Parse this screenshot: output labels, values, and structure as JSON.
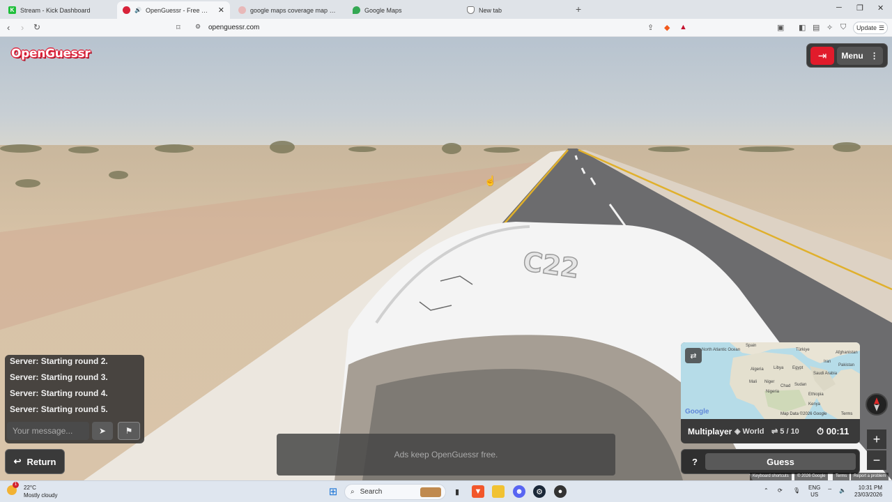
{
  "browser": {
    "tabs": [
      {
        "title": "Stream - Kick Dashboard",
        "fav_color": "#1fbf3b",
        "fav_glyph": "K"
      },
      {
        "title": "OpenGuessr - Free GeoGuessr",
        "fav_color": "#d8233a",
        "fav_glyph": ""
      },
      {
        "title": "google maps coverage map world - S",
        "fav_color": "#e05757",
        "fav_glyph": ""
      },
      {
        "title": "Google Maps",
        "fav_color": "#34a853",
        "fav_glyph": ""
      },
      {
        "title": "New tab",
        "fav_color": "#777777",
        "fav_glyph": ""
      }
    ],
    "url": "openguessr.com",
    "update_label": "Update"
  },
  "game": {
    "logo": "OpenGuessr",
    "menu_label": "Menu",
    "chat_messages": [
      "Server: Starting round 2.",
      "Server: Starting round 3.",
      "Server: Starting round 4.",
      "Server: Starting round 5."
    ],
    "chat_placeholder": "Your message...",
    "return_label": "Return",
    "ad_text": "Ads keep OpenGuessr free.",
    "mode": "Multiplayer",
    "map_name": "World",
    "round": "5 / 10",
    "timer": "00:11",
    "help_label": "?",
    "guess_label": "Guess",
    "car_plate": "C22",
    "map_labels": {
      "north_atlantic": "North Atlantic Ocean",
      "spain": "Spain",
      "turkiye": "Türkiye",
      "iraq": "Iran",
      "algeria": "Algeria",
      "libya": "Libya",
      "egypt": "Egypt",
      "afghanistan": "Afghanistan",
      "pakistan": "Pakistan",
      "mali": "Mali",
      "niger": "Niger",
      "chad": "Chad",
      "saudi": "Saudi Arabia",
      "nigeria": "Nigeria",
      "sudan": "Sudan",
      "ethiopia": "Ethiopia",
      "kenya": "Kenya"
    },
    "map_credit": "Map Data ©2026 Google",
    "map_terms": "Terms",
    "google_footer": [
      "Keyboard shortcuts",
      "© 2026 Google",
      "Terms",
      "Report a problem"
    ]
  },
  "taskbar": {
    "temperature": "22°C",
    "weather": "Mostly cloudy",
    "weather_badge": "1",
    "search_label": "Search",
    "lang_top": "ENG",
    "lang_bottom": "US",
    "time": "10:31 PM",
    "date": "23/03/2026"
  },
  "colors": {
    "brand_red": "#e11b2b",
    "panel_dark": "#3a3a3a"
  }
}
